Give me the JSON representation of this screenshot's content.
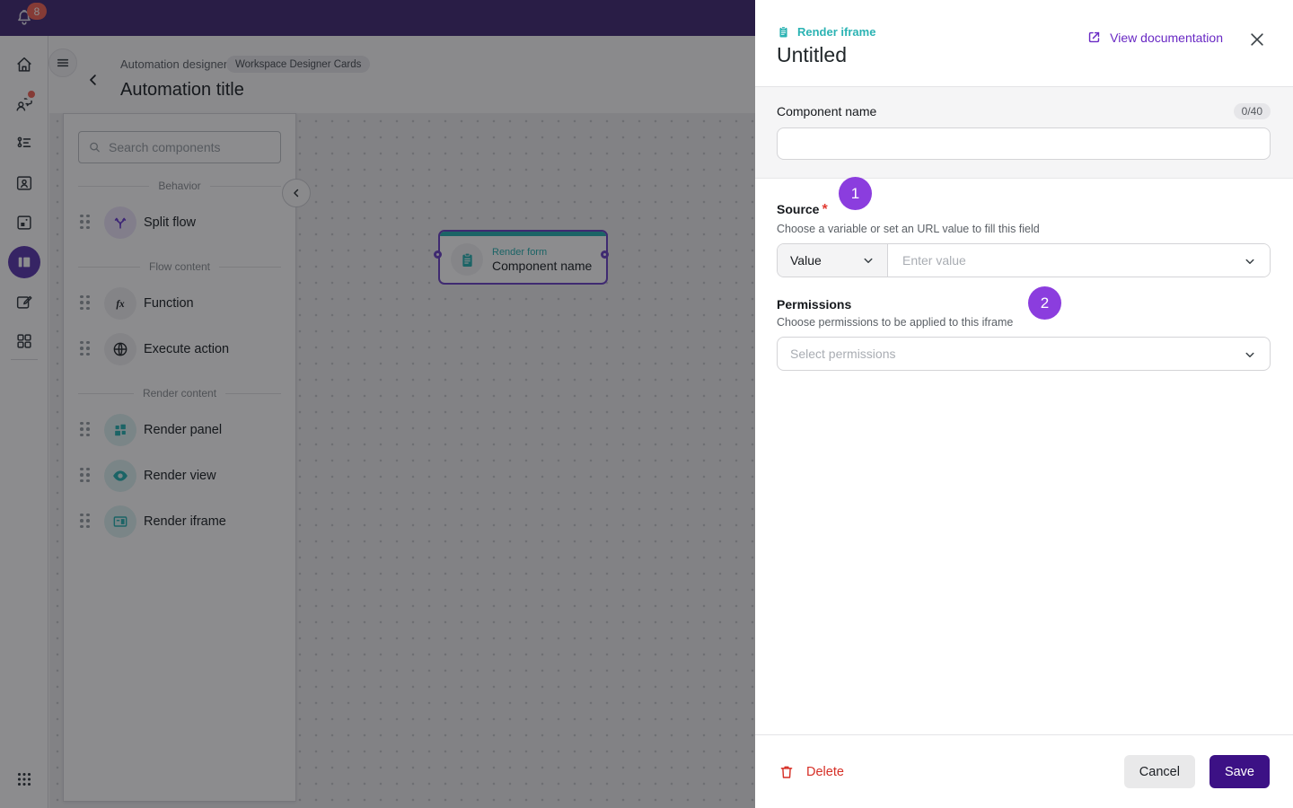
{
  "colors": {
    "topbar_purple": "#452f78",
    "rail_active_purple": "#5e3cb0",
    "notify_red": "#f2675a",
    "teal": "#2bb3b3",
    "accent_purple": "#6929c4",
    "badge_purple": "#8b3dde",
    "node_purple": "#6f46c8",
    "required_red": "#e23b32",
    "delete_red": "#d62f26",
    "save_purple": "#3c1185"
  },
  "topbar": {
    "notification_count": "8"
  },
  "sidebar": {
    "icons": [
      "home-icon",
      "conversations-icon",
      "workflow-list-icon",
      "contact-card-icon",
      "widgets-icon",
      "workspace-designer-icon",
      "compose-icon",
      "apps-grid-icon",
      "app-launcher-icon"
    ],
    "active_icon": "workspace-designer-icon"
  },
  "header": {
    "breadcrumb": "Automation designer",
    "workspace_badge": "Workspace Designer Cards",
    "title": "Automation title"
  },
  "palette": {
    "search_placeholder": "Search components",
    "sections": [
      {
        "label": "Behavior",
        "items": [
          {
            "name": "Split flow",
            "icon": "split-flow-icon"
          }
        ]
      },
      {
        "label": "Flow content",
        "items": [
          {
            "name": "Function",
            "icon": "function-icon"
          },
          {
            "name": "Execute action",
            "icon": "globe-icon"
          }
        ]
      },
      {
        "label": "Render content",
        "items": [
          {
            "name": "Render panel",
            "icon": "render-panel-icon"
          },
          {
            "name": "Render view",
            "icon": "render-view-icon"
          },
          {
            "name": "Render iframe",
            "icon": "render-iframe-icon"
          }
        ]
      }
    ]
  },
  "canvas": {
    "node": {
      "type_label": "Render form",
      "name": "Component name"
    }
  },
  "drawer": {
    "type_label": "Render iframe",
    "title": "Untitled",
    "doc_link": "View documentation",
    "component_name": {
      "label": "Component name",
      "counter": "0/40",
      "value": ""
    },
    "source": {
      "label": "Source",
      "required_mark": "*",
      "helper": "Choose a variable or set an URL value to fill this field",
      "selector_value": "Value",
      "placeholder": "Enter value",
      "step_badge": "1"
    },
    "permissions": {
      "label": "Permissions",
      "helper": "Choose permissions to be applied to this iframe",
      "placeholder": "Select permissions",
      "step_badge": "2"
    },
    "footer": {
      "delete": "Delete",
      "cancel": "Cancel",
      "save": "Save"
    }
  }
}
